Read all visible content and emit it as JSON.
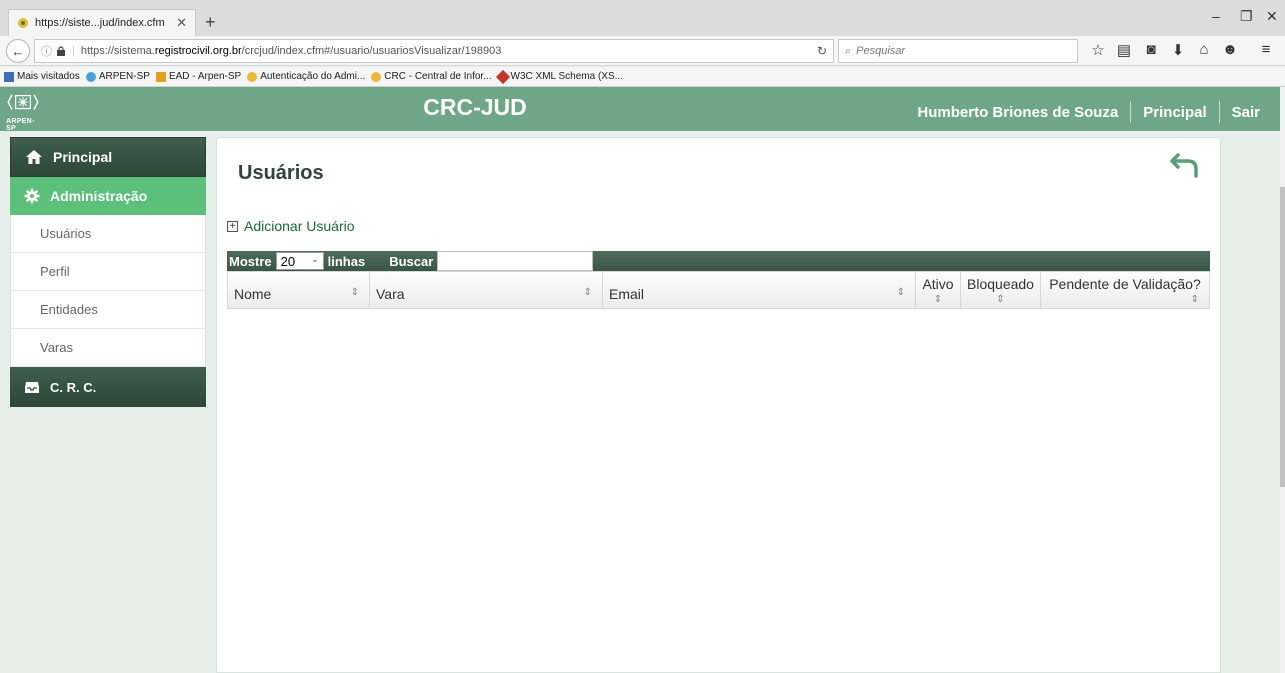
{
  "browser": {
    "tab_title": "https://siste...jud/index.cfm",
    "url_prefix": "https://sistema.",
    "url_domain": "registrocivil.org.br",
    "url_path": "/crcjud/index.cfm#/usuario/usuariosVisualizar/198903",
    "search_placeholder": "Pesquisar",
    "bookmarks": [
      {
        "label": "Mais visitados",
        "color": "#3b6fb6"
      },
      {
        "label": "ARPEN-SP",
        "color": "#4aa0d8"
      },
      {
        "label": "EAD - Arpen-SP",
        "color": "#e0a020"
      },
      {
        "label": "Autenticação do Admi...",
        "color": "#e8b83a"
      },
      {
        "label": "CRC - Central de Infor...",
        "color": "#e8b83a"
      },
      {
        "label": "W3C XML Schema (XS...",
        "color": "#c0392b"
      }
    ]
  },
  "header": {
    "logo_text": "ARPEN-SP",
    "app_title": "CRC-JUD",
    "user_name": "Humberto Briones de Souza",
    "home_link": "Principal",
    "logout_link": "Sair"
  },
  "sidebar": {
    "principal": "Principal",
    "administracao": "Administração",
    "items": [
      "Usuários",
      "Perfil",
      "Entidades",
      "Varas"
    ],
    "crc": "C. R. C."
  },
  "main": {
    "title": "Usuários",
    "add_user": "Adicionar Usuário",
    "show_label": "Mostre",
    "rows_value": "20",
    "rows_label": "linhas",
    "search_label": "Buscar",
    "columns": [
      "Nome",
      "Vara",
      "Email",
      "Ativo",
      "Bloqueado",
      "Pendente de Validação?"
    ]
  },
  "colors": {
    "header_green": "#6ea687",
    "dark_green": "#2d4638",
    "active_green": "#5cc07a"
  }
}
